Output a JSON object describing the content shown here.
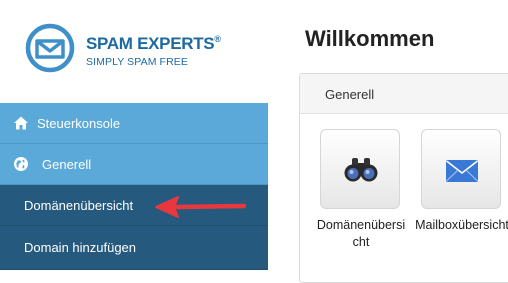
{
  "brand": {
    "title": "SPAM EXPERTS",
    "registered": "®",
    "tagline": "SIMPLY SPAM FREE",
    "color": "#1e6aa0"
  },
  "sidebar": {
    "items": [
      {
        "label": "Steuerkonsole",
        "icon": "home-icon"
      },
      {
        "label": "Generell",
        "icon": "globe-icon"
      },
      {
        "label": "Domänenübersicht"
      },
      {
        "label": "Domain hinzufügen"
      }
    ],
    "colors": {
      "top": "#5ba9d8",
      "sub": "#255a7e"
    }
  },
  "main": {
    "title": "Willkommen",
    "panel": {
      "title": "Generell",
      "tiles": [
        {
          "label": "Domänenübersicht",
          "icon": "binoculars-icon"
        },
        {
          "label": "Mailboxübersicht",
          "icon": "envelope-icon"
        }
      ]
    }
  },
  "annotation": {
    "arrow_color": "#e8383d"
  }
}
